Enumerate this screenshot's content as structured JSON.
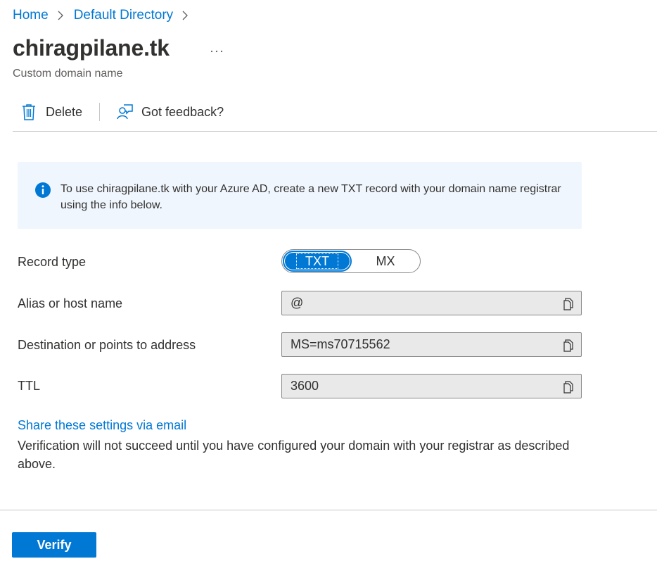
{
  "breadcrumb": {
    "items": [
      "Home",
      "Default Directory"
    ]
  },
  "header": {
    "title": "chiragpilane.tk",
    "more_label": "···",
    "subtitle": "Custom domain name"
  },
  "toolbar": {
    "delete_label": "Delete",
    "feedback_label": "Got feedback?"
  },
  "banner": {
    "message": "To use chiragpilane.tk with your Azure AD, create a new TXT record with your domain name registrar using the info below."
  },
  "form": {
    "record_type": {
      "label": "Record type",
      "options": [
        "TXT",
        "MX"
      ],
      "selected": "TXT"
    },
    "alias": {
      "label": "Alias or host name",
      "value": "@"
    },
    "destination": {
      "label": "Destination or points to address",
      "value": "MS=ms70715562"
    },
    "ttl": {
      "label": "TTL",
      "value": "3600"
    }
  },
  "share_link": "Share these settings via email",
  "note": "Verification will not succeed until you have configured your domain with your registrar as described above.",
  "verify_label": "Verify",
  "colors": {
    "accent": "#0078d4",
    "banner_bg": "#f0f6fd",
    "field_bg": "#e9e9e9"
  }
}
